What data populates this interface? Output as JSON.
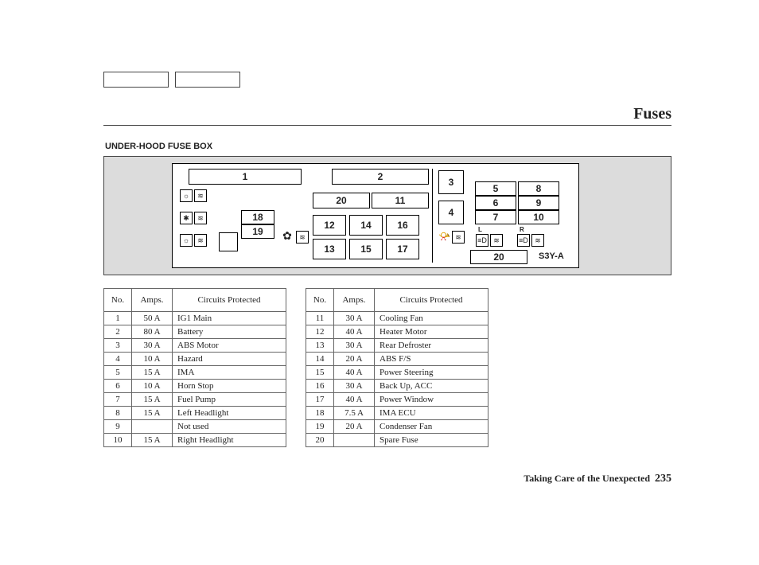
{
  "header": {
    "title": "Fuses"
  },
  "subhead": "UNDER-HOOD FUSE BOX",
  "diagram": {
    "labels": {
      "n1": "1",
      "n2": "2",
      "n3": "3",
      "n4": "4",
      "n5": "5",
      "n6": "6",
      "n7": "7",
      "n8": "8",
      "n9": "9",
      "n10": "10",
      "n11": "11",
      "n12": "12",
      "n13": "13",
      "n14": "14",
      "n15": "15",
      "n16": "16",
      "n17": "17",
      "n18": "18",
      "n19": "19",
      "n20a": "20",
      "n20b": "20",
      "partcode": "S3Y-A",
      "L": "L",
      "R": "R"
    }
  },
  "table_headers": {
    "no": "No.",
    "amps": "Amps.",
    "circuits": "Circuits Protected"
  },
  "tableA": [
    {
      "no": "1",
      "amps": "50 A",
      "circ": "IG1 Main"
    },
    {
      "no": "2",
      "amps": "80 A",
      "circ": "Battery"
    },
    {
      "no": "3",
      "amps": "30 A",
      "circ": "ABS Motor"
    },
    {
      "no": "4",
      "amps": "10 A",
      "circ": "Hazard"
    },
    {
      "no": "5",
      "amps": "15 A",
      "circ": "IMA"
    },
    {
      "no": "6",
      "amps": "10 A",
      "circ": "Horn Stop"
    },
    {
      "no": "7",
      "amps": "15 A",
      "circ": "Fuel Pump"
    },
    {
      "no": "8",
      "amps": "15 A",
      "circ": "Left Headlight"
    },
    {
      "no": "9",
      "amps": "",
      "circ": "Not used"
    },
    {
      "no": "10",
      "amps": "15 A",
      "circ": "Right Headlight"
    }
  ],
  "tableB": [
    {
      "no": "11",
      "amps": "30 A",
      "circ": "Cooling Fan"
    },
    {
      "no": "12",
      "amps": "40 A",
      "circ": "Heater Motor"
    },
    {
      "no": "13",
      "amps": "30 A",
      "circ": "Rear Defroster"
    },
    {
      "no": "14",
      "amps": "20 A",
      "circ": "ABS F/S"
    },
    {
      "no": "15",
      "amps": "40 A",
      "circ": "Power Steering"
    },
    {
      "no": "16",
      "amps": "30 A",
      "circ": "Back Up, ACC"
    },
    {
      "no": "17",
      "amps": "40 A",
      "circ": "Power Window"
    },
    {
      "no": "18",
      "amps": "7.5 A",
      "circ": "IMA ECU"
    },
    {
      "no": "19",
      "amps": "20 A",
      "circ": "Condenser Fan"
    },
    {
      "no": "20",
      "amps": "",
      "circ": "Spare Fuse"
    }
  ],
  "footer": {
    "section": "Taking Care of the Unexpected",
    "page": "235"
  }
}
